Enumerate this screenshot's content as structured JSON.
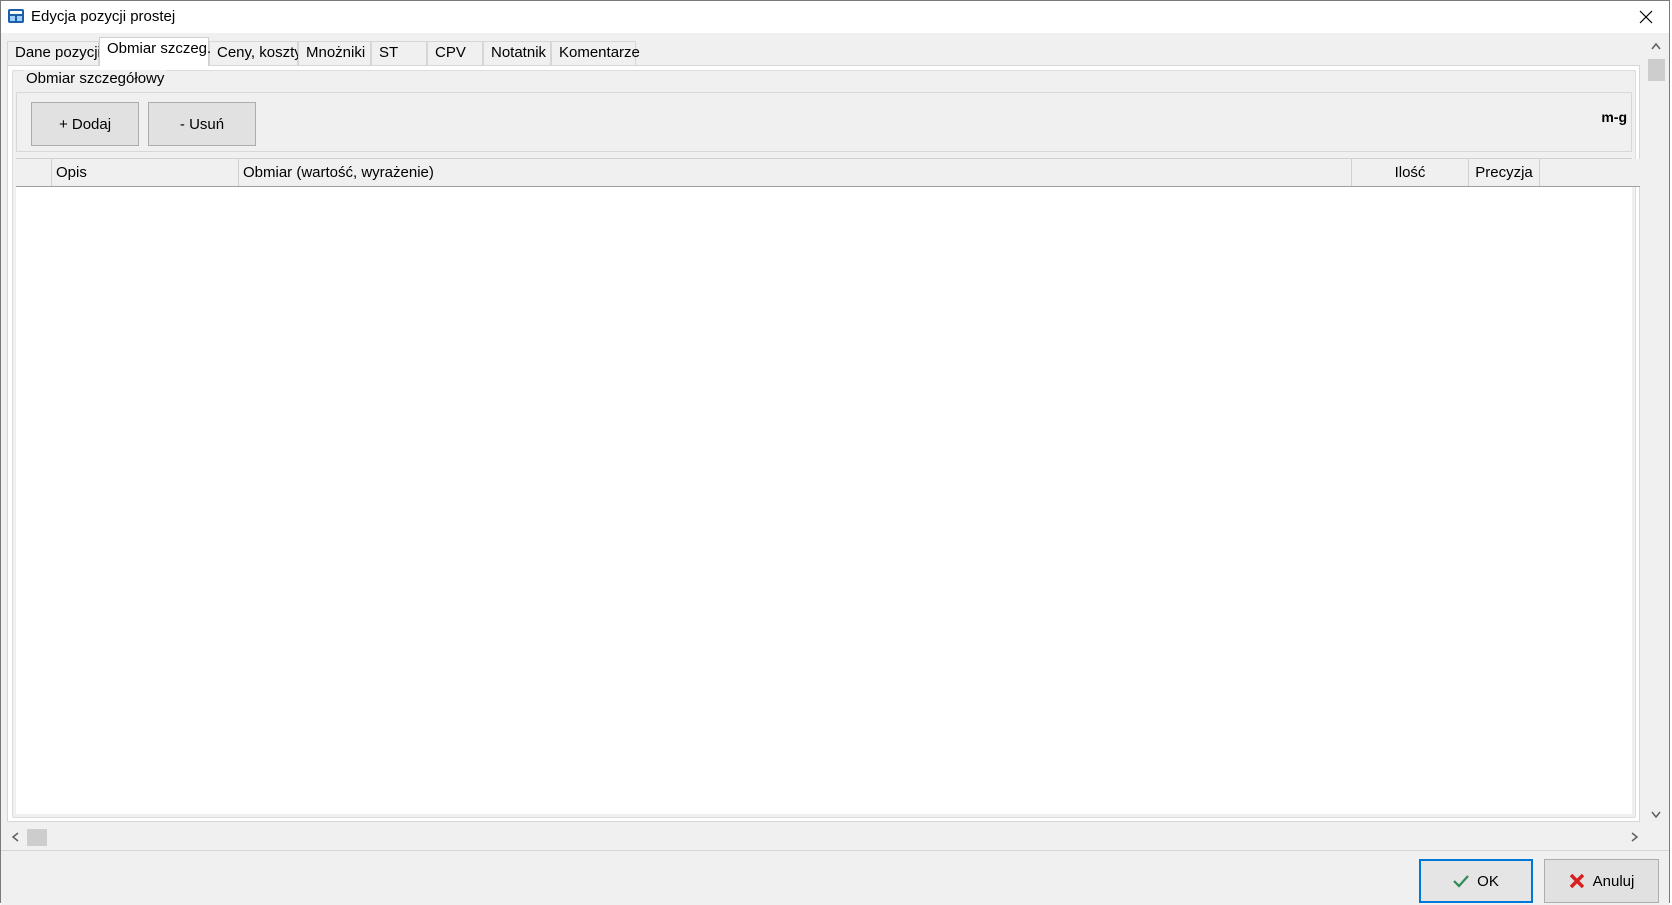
{
  "window": {
    "title": "Edycja pozycji prostej"
  },
  "tabs": [
    {
      "label": "Dane pozycji"
    },
    {
      "label": "Obmiar szczeg."
    },
    {
      "label": "Ceny, koszty"
    },
    {
      "label": "Mnożniki"
    },
    {
      "label": "ST"
    },
    {
      "label": "CPV"
    },
    {
      "label": "Notatnik"
    },
    {
      "label": "Komentarze"
    }
  ],
  "active_tab": "Obmiar szczeg.",
  "group": {
    "label": "Obmiar szczegółowy",
    "toolbar": {
      "add_label": "+ Dodaj",
      "remove_label": "- Usuń",
      "indicator": "m-g"
    },
    "grid": {
      "columns": [
        "",
        "Opis",
        "Obmiar (wartość, wyrażenie)",
        "Ilość",
        "Precyzja"
      ],
      "rows": []
    }
  },
  "footer": {
    "ok_label": "OK",
    "cancel_label": "Anuluj"
  },
  "colors": {
    "accent": "#0078d7",
    "ok_check": "#2e8b57",
    "cancel_x": "#d82020"
  },
  "icons": [
    "app-icon",
    "close-icon",
    "checkmark-icon",
    "cross-icon",
    "scroll-up-arrow",
    "scroll-down-arrow",
    "scroll-left-arrow",
    "scroll-right-arrow"
  ]
}
